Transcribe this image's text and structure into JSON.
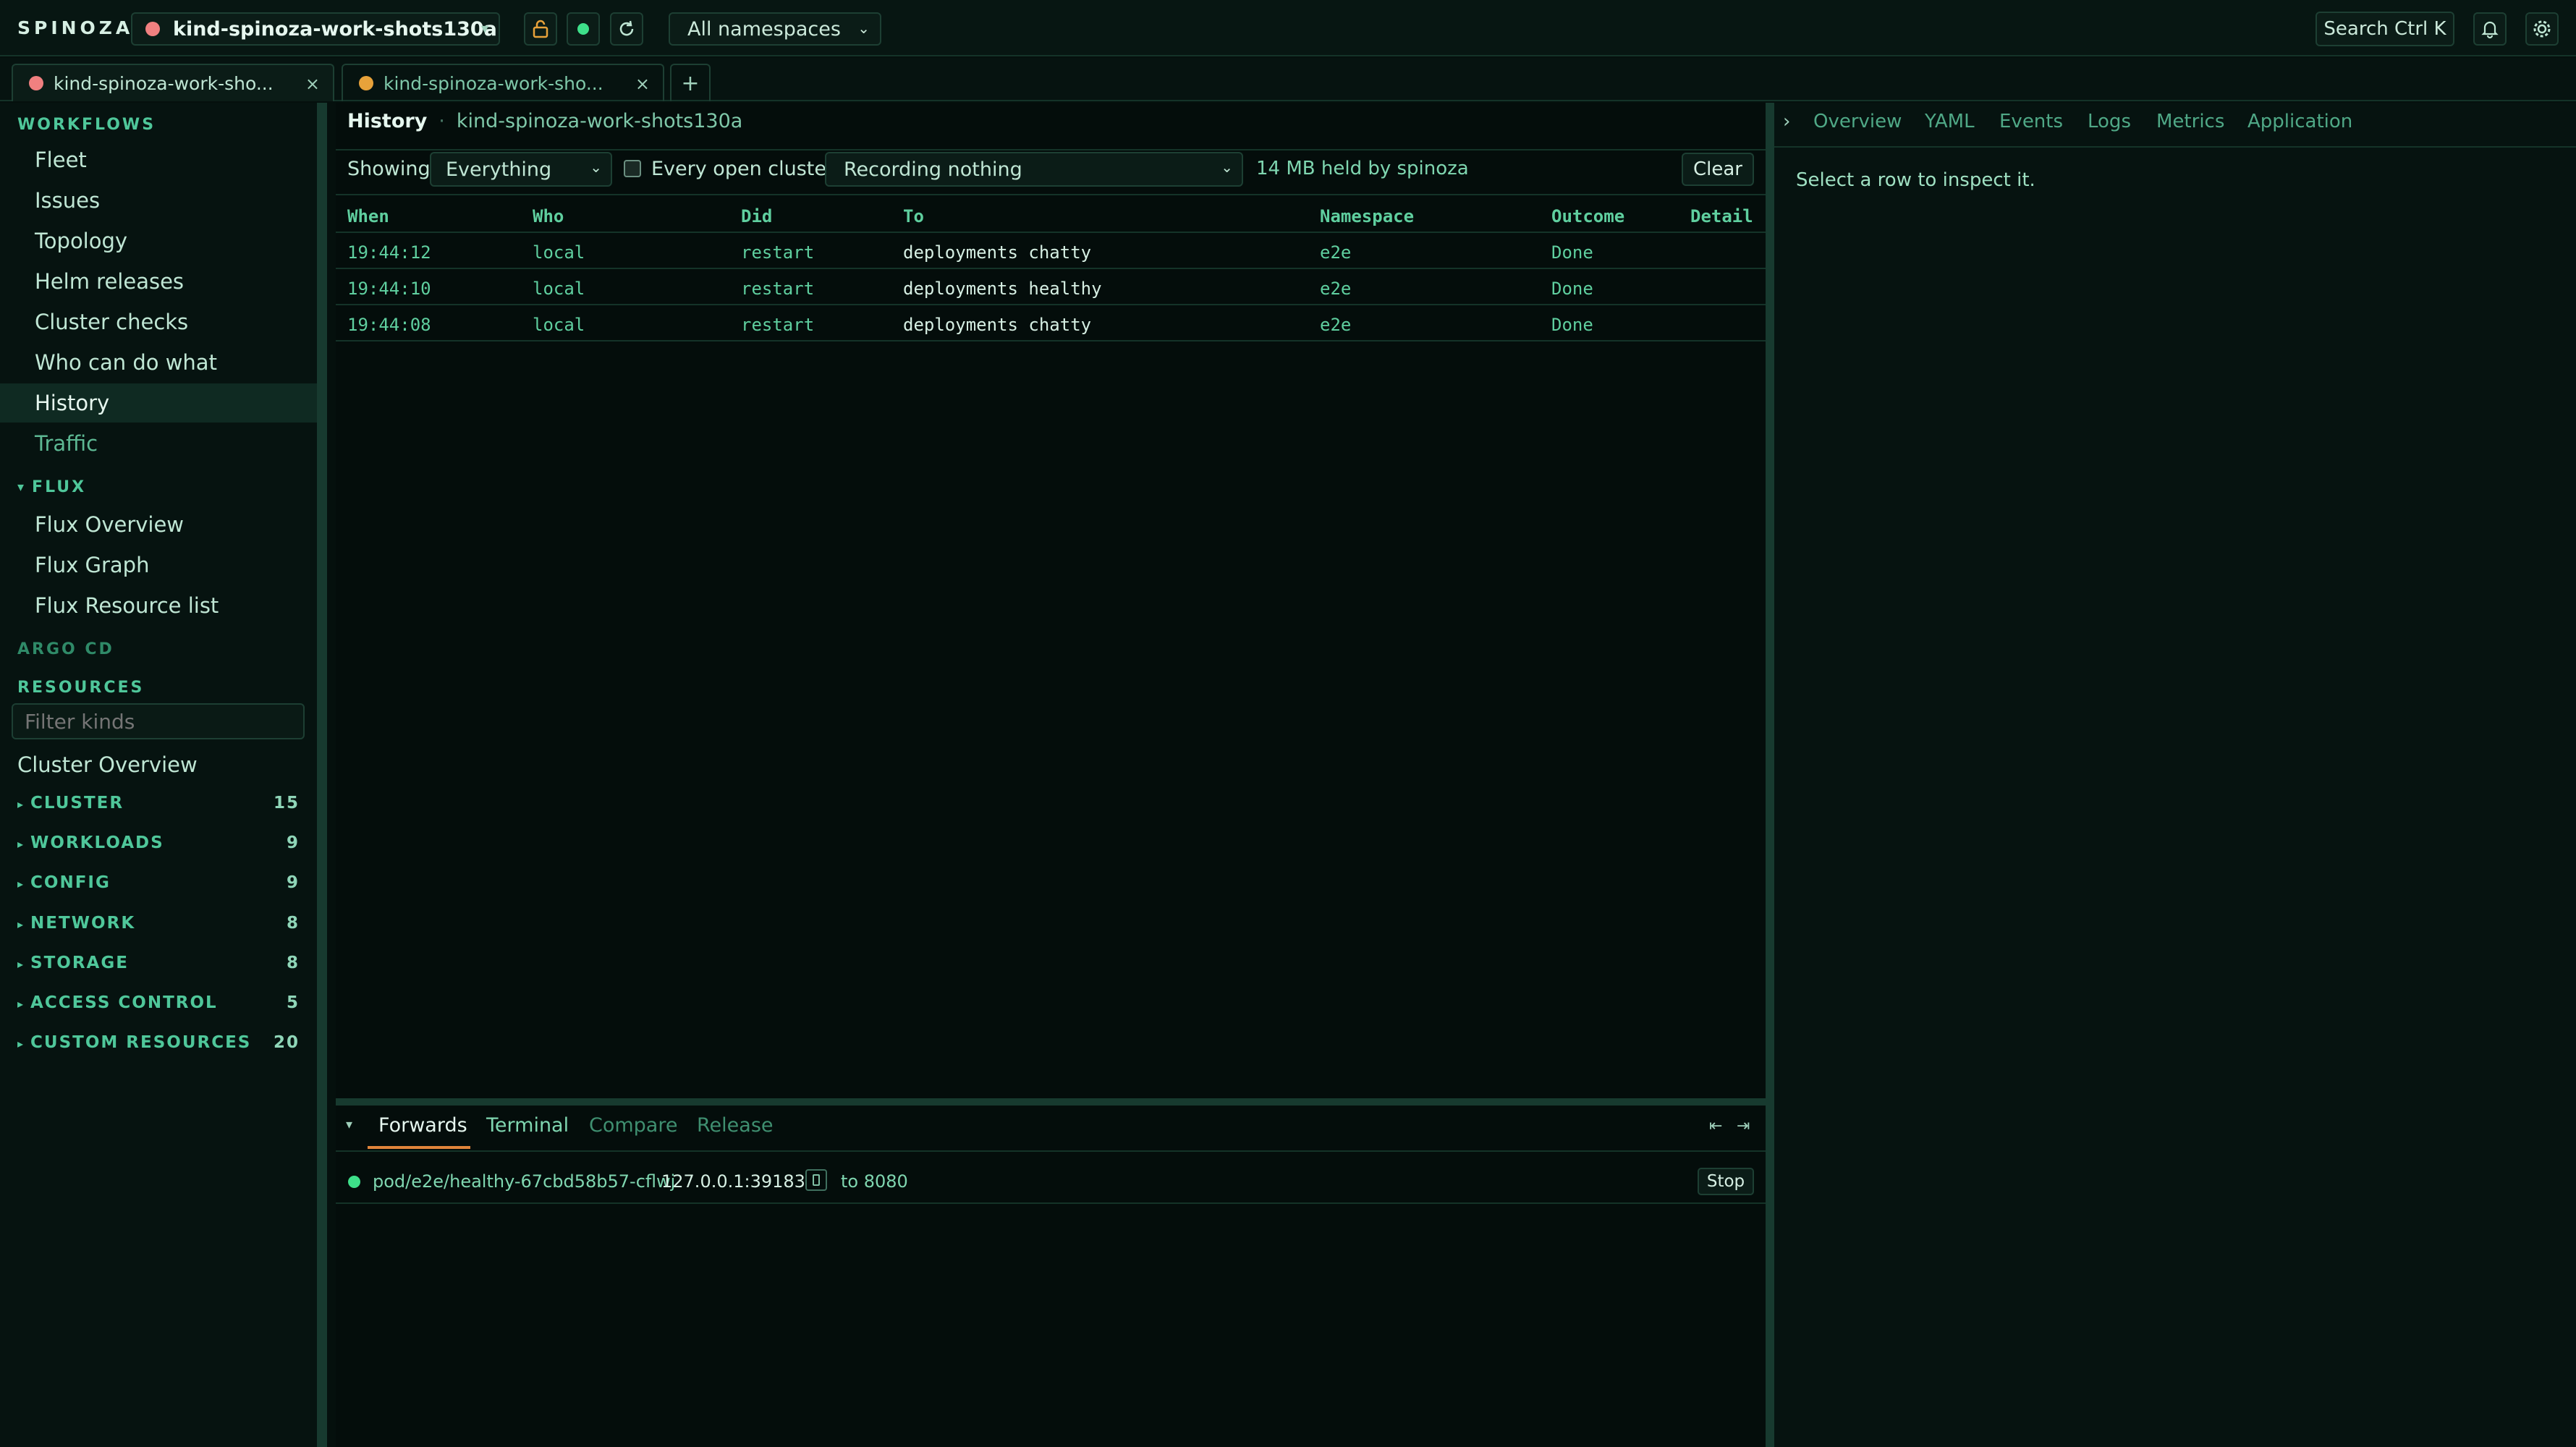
{
  "topbar": {
    "brand": "SPINOZA",
    "cluster": "kind-spinoza-work-shots130a",
    "namespace": "All namespaces",
    "search_label": "Search Ctrl K",
    "icons": [
      "lock-icon",
      "status-dot-icon",
      "refresh-icon",
      "bell-icon",
      "gear-icon"
    ]
  },
  "tabs": [
    {
      "label": "kind-spinoza-work-sho...",
      "status_color": "#f08080"
    },
    {
      "label": "kind-spinoza-work-sho...",
      "status_color": "#e8a23a"
    }
  ],
  "sidebar": {
    "workflows_head": "WORKFLOWS",
    "workflows": [
      "Fleet",
      "Issues",
      "Topology",
      "Helm releases",
      "Cluster checks",
      "Who can do what",
      "History",
      "Traffic"
    ],
    "active_item": "History",
    "flux_head": "FLUX",
    "flux_arrow": "▾",
    "flux": [
      "Flux Overview",
      "Flux Graph",
      "Flux Resource list"
    ],
    "argo_head": "ARGO CD",
    "resources_head": "RESOURCES",
    "filter_placeholder": "Filter kinds",
    "cluster_overview": "Cluster Overview",
    "groups": [
      {
        "label": "CLUSTER",
        "count": "15"
      },
      {
        "label": "WORKLOADS",
        "count": "9"
      },
      {
        "label": "CONFIG",
        "count": "9"
      },
      {
        "label": "NETWORK",
        "count": "8"
      },
      {
        "label": "STORAGE",
        "count": "8"
      },
      {
        "label": "ACCESS CONTROL",
        "count": "5"
      },
      {
        "label": "CUSTOM RESOURCES",
        "count": "20"
      }
    ]
  },
  "main": {
    "title": "History",
    "separator": "·",
    "context": "kind-spinoza-work-shots130a",
    "showing_label": "Showing",
    "showing_value": "Everything",
    "every_cluster_label": "Every open cluster",
    "recording_value": "Recording nothing",
    "memory": "14 MB held by spinoza",
    "clear_label": "Clear",
    "columns": [
      "When",
      "Who",
      "Did",
      "To",
      "Namespace",
      "Outcome",
      "Detail"
    ],
    "rows": [
      {
        "when": "19:44:12",
        "who": "local",
        "did": "restart",
        "to": "deployments chatty",
        "ns": "e2e",
        "outcome": "Done",
        "detail": ""
      },
      {
        "when": "19:44:10",
        "who": "local",
        "did": "restart",
        "to": "deployments healthy",
        "ns": "e2e",
        "outcome": "Done",
        "detail": ""
      },
      {
        "when": "19:44:08",
        "who": "local",
        "did": "restart",
        "to": "deployments chatty",
        "ns": "e2e",
        "outcome": "Done",
        "detail": ""
      }
    ]
  },
  "bottom": {
    "collapse_arrow": "▾",
    "tabs": [
      "Forwards",
      "Terminal",
      "Compare",
      "Release"
    ],
    "active_tab": "Forwards",
    "forward": {
      "target": "pod/e2e/healthy-67cbd58b57-cflwj",
      "address": "127.0.0.1:39183",
      "port_text": "to 8080",
      "stop_label": "Stop"
    }
  },
  "inspector": {
    "collapse_arrow": "›",
    "tabs": [
      "Overview",
      "YAML",
      "Events",
      "Logs",
      "Metrics",
      "Application"
    ],
    "empty_message": "Select a row to inspect it."
  },
  "colors": {
    "background": "#05100d",
    "accent": "#4fc79a",
    "active_tab_underline": "#e0843a",
    "status_green": "#3ee08a"
  }
}
